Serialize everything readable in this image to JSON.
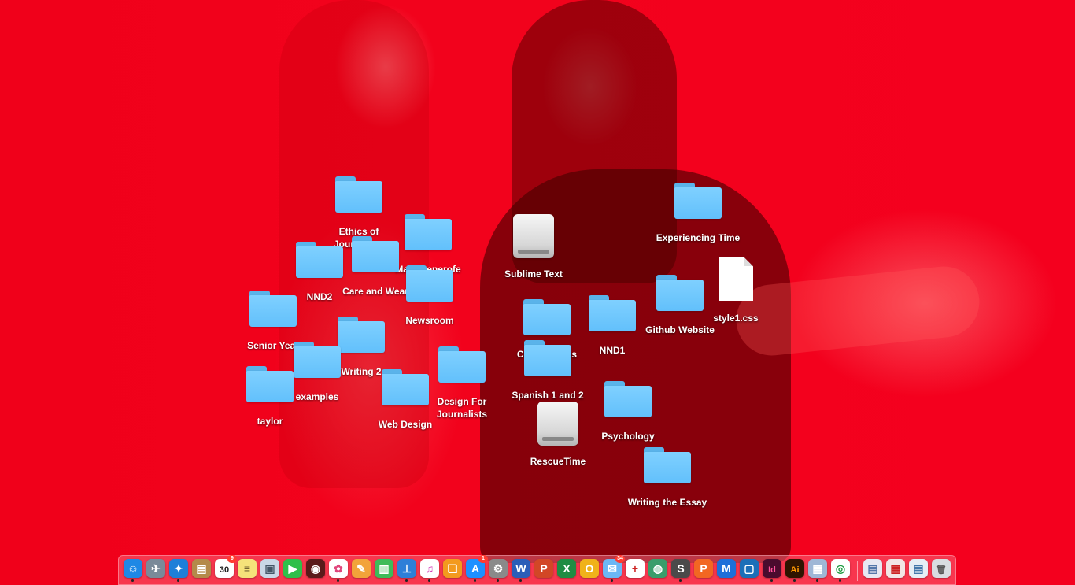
{
  "desktop_icons": [
    {
      "name": "folder-ethics-of-journalism",
      "kind": "folder",
      "label": "Ethics of Journalism"
    },
    {
      "name": "folder-mark-benerofe",
      "kind": "folder",
      "label": "Mark Benerofe"
    },
    {
      "name": "folder-care-and-wear",
      "kind": "folder",
      "label": "Care and Wear"
    },
    {
      "name": "folder-nnd2",
      "kind": "folder",
      "label": "NND2"
    },
    {
      "name": "folder-newsroom",
      "kind": "folder",
      "label": "Newsroom"
    },
    {
      "name": "folder-senior-year",
      "kind": "folder",
      "label": "Senior Year"
    },
    {
      "name": "folder-writing-2",
      "kind": "folder",
      "label": "Writing 2"
    },
    {
      "name": "folder-examples",
      "kind": "folder",
      "label": "examples"
    },
    {
      "name": "folder-taylor",
      "kind": "folder",
      "label": "taylor"
    },
    {
      "name": "folder-web-design",
      "kind": "folder",
      "label": "Web Design"
    },
    {
      "name": "folder-design-for-journalists",
      "kind": "folder",
      "label": "Design For Journalists"
    },
    {
      "name": "drive-sublime-text",
      "kind": "drive",
      "label": "Sublime Text"
    },
    {
      "name": "folder-college-apps",
      "kind": "folder",
      "label": "College Apps"
    },
    {
      "name": "folder-spanish-1-and-2",
      "kind": "folder",
      "label": "Spanish 1 and 2"
    },
    {
      "name": "drive-rescuetime",
      "kind": "drive",
      "label": "RescueTime"
    },
    {
      "name": "folder-nnd1",
      "kind": "folder",
      "label": "NND1"
    },
    {
      "name": "folder-psychology",
      "kind": "folder",
      "label": "Psychology"
    },
    {
      "name": "folder-experiencing-time",
      "kind": "folder",
      "label": "Experiencing Time"
    },
    {
      "name": "folder-github-website",
      "kind": "folder",
      "label": "Github Website"
    },
    {
      "name": "file-style1-css",
      "kind": "document",
      "label": "style1.css"
    },
    {
      "name": "folder-writing-the-essay",
      "kind": "folder",
      "label": "Writing the Essay"
    }
  ],
  "dock": {
    "apps": [
      {
        "name": "finder",
        "icon": "finder-icon",
        "glyph": "☺",
        "color": "#1e88e5",
        "running": true
      },
      {
        "name": "launchpad",
        "icon": "rocket-icon",
        "glyph": "✈",
        "color": "#7a8a99",
        "running": false
      },
      {
        "name": "safari",
        "icon": "compass-icon",
        "glyph": "✦",
        "color": "#1e7fd8",
        "running": true
      },
      {
        "name": "notefile",
        "icon": "notebook-icon",
        "glyph": "▤",
        "color": "#b48a4a",
        "running": false
      },
      {
        "name": "calendar",
        "icon": "calendar-icon",
        "glyph": "30",
        "color": "#ffffff",
        "text_color": "#222222",
        "badge": "9",
        "running": false
      },
      {
        "name": "notes",
        "icon": "notes-icon",
        "glyph": "≡",
        "color": "#f5e27a",
        "text_color": "#776633",
        "running": false
      },
      {
        "name": "preview",
        "icon": "photos-stack-icon",
        "glyph": "▣",
        "color": "#c9d7e6",
        "text_color": "#445566",
        "running": false
      },
      {
        "name": "facetime",
        "icon": "video-camera-icon",
        "glyph": "▶",
        "color": "#2fbf4a",
        "running": false
      },
      {
        "name": "photo-booth",
        "icon": "photo-booth-icon",
        "glyph": "◉",
        "color": "#5a1a1a",
        "running": false
      },
      {
        "name": "photos",
        "icon": "pinwheel-icon",
        "glyph": "✿",
        "color": "#ffffff",
        "text_color": "#e0457b",
        "running": true
      },
      {
        "name": "pages",
        "icon": "pages-icon",
        "glyph": "✎",
        "color": "#f2a33a",
        "running": false
      },
      {
        "name": "numbers",
        "icon": "bar-chart-icon",
        "glyph": "▥",
        "color": "#3dbb59",
        "running": false
      },
      {
        "name": "keynote",
        "icon": "podium-icon",
        "glyph": "⊥",
        "color": "#2e7fd8",
        "running": true
      },
      {
        "name": "itunes",
        "icon": "music-note-icon",
        "glyph": "♫",
        "color": "#ffffff",
        "text_color": "#d33fb8",
        "running": true
      },
      {
        "name": "ibooks",
        "icon": "open-book-icon",
        "glyph": "❏",
        "color": "#f39a1e",
        "running": false
      },
      {
        "name": "app-store",
        "icon": "app-store-icon",
        "glyph": "A",
        "color": "#1e90ff",
        "badge": "1",
        "running": true
      },
      {
        "name": "system-preferences",
        "icon": "gear-icon",
        "glyph": "⚙",
        "color": "#8a8a8a",
        "running": true
      },
      {
        "name": "word",
        "icon": "word-icon",
        "glyph": "W",
        "color": "#2b5eb8",
        "running": true
      },
      {
        "name": "powerpoint",
        "icon": "powerpoint-icon",
        "glyph": "P",
        "color": "#d24726",
        "running": false
      },
      {
        "name": "excel",
        "icon": "excel-icon",
        "glyph": "X",
        "color": "#1f8c43",
        "running": false
      },
      {
        "name": "outlook",
        "icon": "outlook-icon",
        "glyph": "O",
        "color": "#f0b21a",
        "running": false
      },
      {
        "name": "messages",
        "icon": "chat-bubble-icon",
        "glyph": "✉",
        "color": "#6bb7f5",
        "badge": "34",
        "running": true
      },
      {
        "name": "crossover",
        "icon": "cross-icon",
        "glyph": "+",
        "color": "#ffffff",
        "text_color": "#cc2222",
        "running": false
      },
      {
        "name": "network-utility",
        "icon": "globe-icon",
        "glyph": "◍",
        "color": "#3a9d6b",
        "running": false
      },
      {
        "name": "sublime-text",
        "icon": "sublime-icon",
        "glyph": "S",
        "color": "#4a4a4a",
        "running": true
      },
      {
        "name": "pocket",
        "icon": "p-icon",
        "glyph": "P",
        "color": "#f26722",
        "running": false
      },
      {
        "name": "malwarebytes",
        "icon": "m-icon",
        "glyph": "M",
        "color": "#1e6fd9",
        "running": false
      },
      {
        "name": "github",
        "icon": "box-icon",
        "glyph": "▢",
        "color": "#1c6fb8",
        "running": false
      },
      {
        "name": "indesign",
        "icon": "indesign-icon",
        "glyph": "Id",
        "color": "#4a0b2e",
        "text_color": "#ff4f9a",
        "running": true
      },
      {
        "name": "illustrator",
        "icon": "illustrator-icon",
        "glyph": "Ai",
        "color": "#2f1400",
        "text_color": "#ff9a00",
        "running": true
      },
      {
        "name": "preview-photos",
        "icon": "images-icon",
        "glyph": "▦",
        "color": "#9fb7d6",
        "running": true
      },
      {
        "name": "chrome",
        "icon": "chrome-icon",
        "glyph": "◎",
        "color": "#ffffff",
        "text_color": "#1f9b42",
        "running": true
      }
    ],
    "stacks": [
      {
        "name": "downloads-stack",
        "icon": "document-stack-icon",
        "glyph": "▤",
        "color": "#e8e8f2",
        "text_color": "#5577aa"
      },
      {
        "name": "documents-stack",
        "icon": "calendar-stack-icon",
        "glyph": "▦",
        "color": "#f2e6e6",
        "text_color": "#cc2222"
      },
      {
        "name": "desktop-stack",
        "icon": "files-stack-icon",
        "glyph": "▤",
        "color": "#e6eef5",
        "text_color": "#4477aa"
      },
      {
        "name": "trash",
        "icon": "trash-icon",
        "glyph": "🗑",
        "color": "#d9dde1",
        "text_color": "#555555"
      }
    ]
  }
}
